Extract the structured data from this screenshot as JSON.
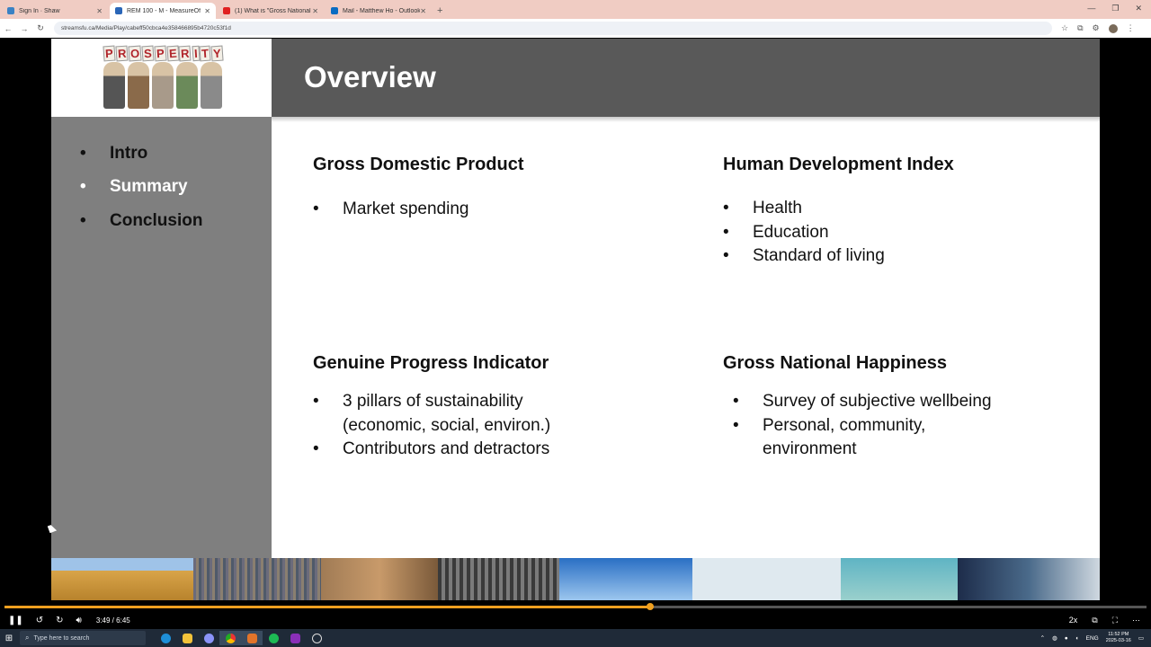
{
  "browser": {
    "tabs": [
      {
        "title": "Sign In · Shaw",
        "active": false,
        "color": "#3b82c4"
      },
      {
        "title": "REM 100 - M - MeasureOf",
        "active": true,
        "color": "#2a66b8"
      },
      {
        "title": "(1) What is \"Gross National Ha",
        "active": false,
        "color": "#e02020"
      },
      {
        "title": "Mail - Matthew Ho - Outlook",
        "active": false,
        "color": "#0a6cc2"
      }
    ],
    "new_tab_symbol": "+",
    "url": "streamsfu.ca/Media/Play/cabeff50cbca4e358466895b4720c53f1d"
  },
  "slide": {
    "header_title": "Overview",
    "logo_letters": [
      "P",
      "R",
      "O",
      "S",
      "P",
      "E",
      "R",
      "I",
      "T",
      "Y"
    ],
    "sidebar": {
      "items": [
        {
          "label": "Intro",
          "active": false
        },
        {
          "label": "Summary",
          "active": true
        },
        {
          "label": "Conclusion",
          "active": false
        }
      ]
    },
    "sections": {
      "gdp": {
        "title": "Gross Domestic Product",
        "bullets": [
          "Market spending"
        ]
      },
      "hdi": {
        "title": "Human Development Index",
        "bullets": [
          "Health",
          "Education",
          "Standard of living"
        ]
      },
      "gpi": {
        "title": "Genuine Progress Indicator",
        "bullets": [
          "3 pillars of sustainability",
          "Contributors and detractors"
        ],
        "bullet_continuation": "(economic, social, environ.)"
      },
      "gnh": {
        "title": "Gross National Happiness",
        "bullets": [
          "Survey of subjective wellbeing",
          "Personal, community,"
        ],
        "bullet_continuation": "environment"
      }
    }
  },
  "video": {
    "current_time": "3:49",
    "separator": "/",
    "duration": "6:45",
    "progress_fraction": 0.565,
    "speed": "2x"
  },
  "taskbar": {
    "search_placeholder": "Type here to search",
    "language": "ENG",
    "time": "11:52 PM",
    "date": "2025-03-16"
  }
}
